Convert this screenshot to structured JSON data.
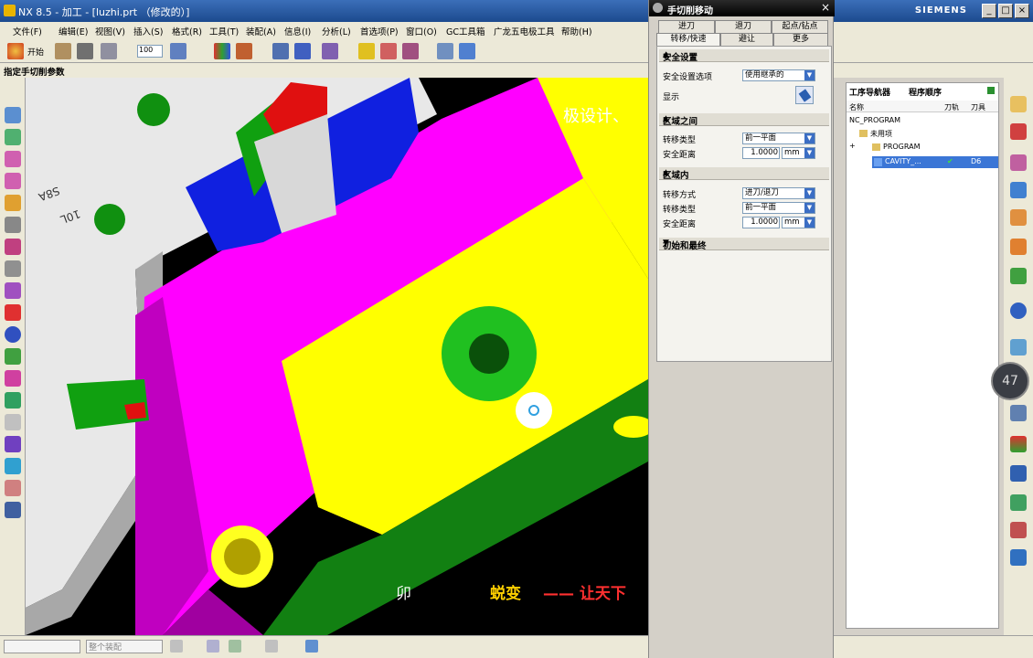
{
  "window": {
    "title": "NX 8.5 - 加工 - [luzhi.prt （修改的）]",
    "brand": "SIEMENS",
    "controls": [
      "_",
      "□",
      "×"
    ]
  },
  "menu": [
    "文件(F)",
    "编辑(E)",
    "视图(V)",
    "插入(S)",
    "格式(R)",
    "工具(T)",
    "装配(A)",
    "信息(I)",
    "分析(L)",
    "首选项(P)",
    "窗口(O)",
    "GC工具箱",
    "广龙五电极工具",
    "帮助(H)"
  ],
  "toolbar": {
    "start_label": "开始",
    "zoom_value": "100"
  },
  "status_prompt": "指定手切削参数",
  "viewport": {
    "overlay_text_1": "极设计、",
    "overlay_text_2_a": "蜕变",
    "overlay_text_2_b": "—— 让天下",
    "overlay_text_3": "卯",
    "part_labels": [
      "S8A",
      "10L"
    ]
  },
  "dialog": {
    "title": "手切削移动",
    "tabs_row1": [
      "进刀",
      "退刀",
      "起点/钻点"
    ],
    "tabs_row2": [
      "转移/快速",
      "避让",
      "更多"
    ],
    "sections": {
      "safety": {
        "header": "安全设置",
        "option_label": "安全设置选项",
        "option_value": "使用继承的",
        "display_label": "显示"
      },
      "between_regions": {
        "header": "区域之间",
        "transfer_type_label": "转移类型",
        "transfer_type_value": "前一平面",
        "safe_distance_label": "安全距离",
        "safe_distance_value": "1.0000",
        "unit": "mm"
      },
      "within_region": {
        "header": "区域内",
        "transfer_mode_label": "转移方式",
        "transfer_mode_value": "进刀/退刀",
        "transfer_type_label": "转移类型",
        "transfer_type_value": "前一平面",
        "safe_distance_label": "安全距离",
        "safe_distance_value": "1.0000",
        "unit": "mm"
      },
      "initial_final": {
        "header": "初始和最终"
      }
    }
  },
  "navigator": {
    "title": "工序导航器",
    "subtitle": "程序顺序",
    "columns": [
      "名称",
      "刀轨",
      "刀具"
    ],
    "rows": [
      {
        "name": "NC_PROGRAM",
        "path": "",
        "tool": ""
      },
      {
        "name": "未用项",
        "path": "",
        "tool": ""
      },
      {
        "name": "PROGRAM",
        "path": "",
        "tool": ""
      },
      {
        "name": "CAVITY_...",
        "path": "✔",
        "tool": "D6"
      }
    ]
  },
  "zoom_badge": "47",
  "bottom": {
    "filter_label": "整个装配"
  }
}
